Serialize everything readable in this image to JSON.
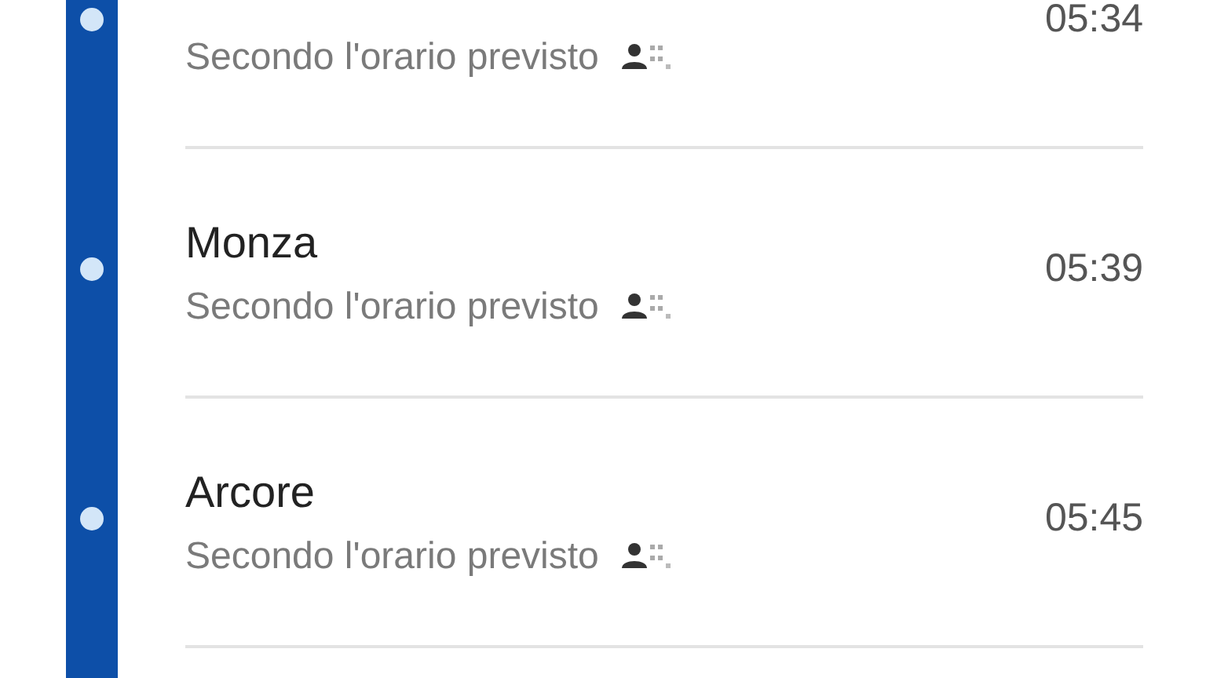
{
  "stops": [
    {
      "subtitle": "Secondo l'orario previsto",
      "time": "05:34"
    },
    {
      "name": "Monza",
      "subtitle": "Secondo l'orario previsto",
      "time": "05:39"
    },
    {
      "name": "Arcore",
      "subtitle": "Secondo l'orario previsto",
      "time": "05:45"
    }
  ]
}
